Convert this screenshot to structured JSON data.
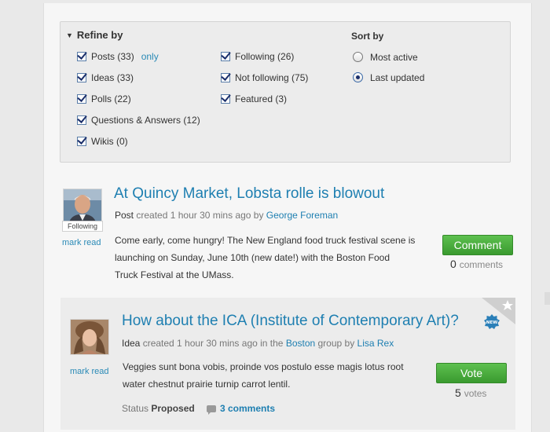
{
  "refine": {
    "title": "Refine by",
    "left_filters": [
      {
        "label": "Posts (33)",
        "checked": true
      },
      {
        "label": "Ideas (33)",
        "checked": true
      },
      {
        "label": "Polls (22)",
        "checked": true
      },
      {
        "label": "Questions & Answers (12)",
        "checked": true
      },
      {
        "label": "Wikis (0)",
        "checked": true
      }
    ],
    "only_label": "only",
    "right_filters": [
      {
        "label": "Following (26)",
        "checked": true
      },
      {
        "label": "Not following (75)",
        "checked": true
      },
      {
        "label": "Featured (3)",
        "checked": true
      }
    ]
  },
  "sort": {
    "title": "Sort by",
    "options": [
      {
        "label": "Most active",
        "selected": false
      },
      {
        "label": "Last updated",
        "selected": true
      }
    ]
  },
  "posts": [
    {
      "title": "At Quincy Market, Lobsta rolle is blowout",
      "type": "Post",
      "meta_created": " created 1 hour 30 mins ago by ",
      "author": "George Foreman",
      "following_tag": "Following",
      "mark_read": "mark read",
      "body_lines": [
        "Come early, come hungry! The New England food truck festival scene is",
        "launching on Sunday, June 10th (new date!) with the Boston Food",
        "Truck Festival at the UMass."
      ],
      "button": "Comment",
      "count": "0",
      "count_label": "comments"
    },
    {
      "title": "How about the ICA (Institute of Contemporary Art)?",
      "type": "Idea",
      "meta_created": " created 1 hour 30 mins ago in the ",
      "group": "Boston",
      "meta_group_by": " group by ",
      "author": "Lisa Rex",
      "mark_read": "mark read",
      "new_badge": "NEW",
      "body_lines": [
        "Veggies sunt bona vobis, proinde vos postulo esse magis lotus root",
        "water chestnut prairie turnip carrot lentil."
      ],
      "button": "Vote",
      "count": "5",
      "count_label": "votes",
      "status_label": "Status",
      "status_value": "Proposed",
      "comments_link": "3 comments"
    }
  ],
  "colors": {
    "link": "#1e7fb1",
    "button_green": "#4cae3f"
  }
}
